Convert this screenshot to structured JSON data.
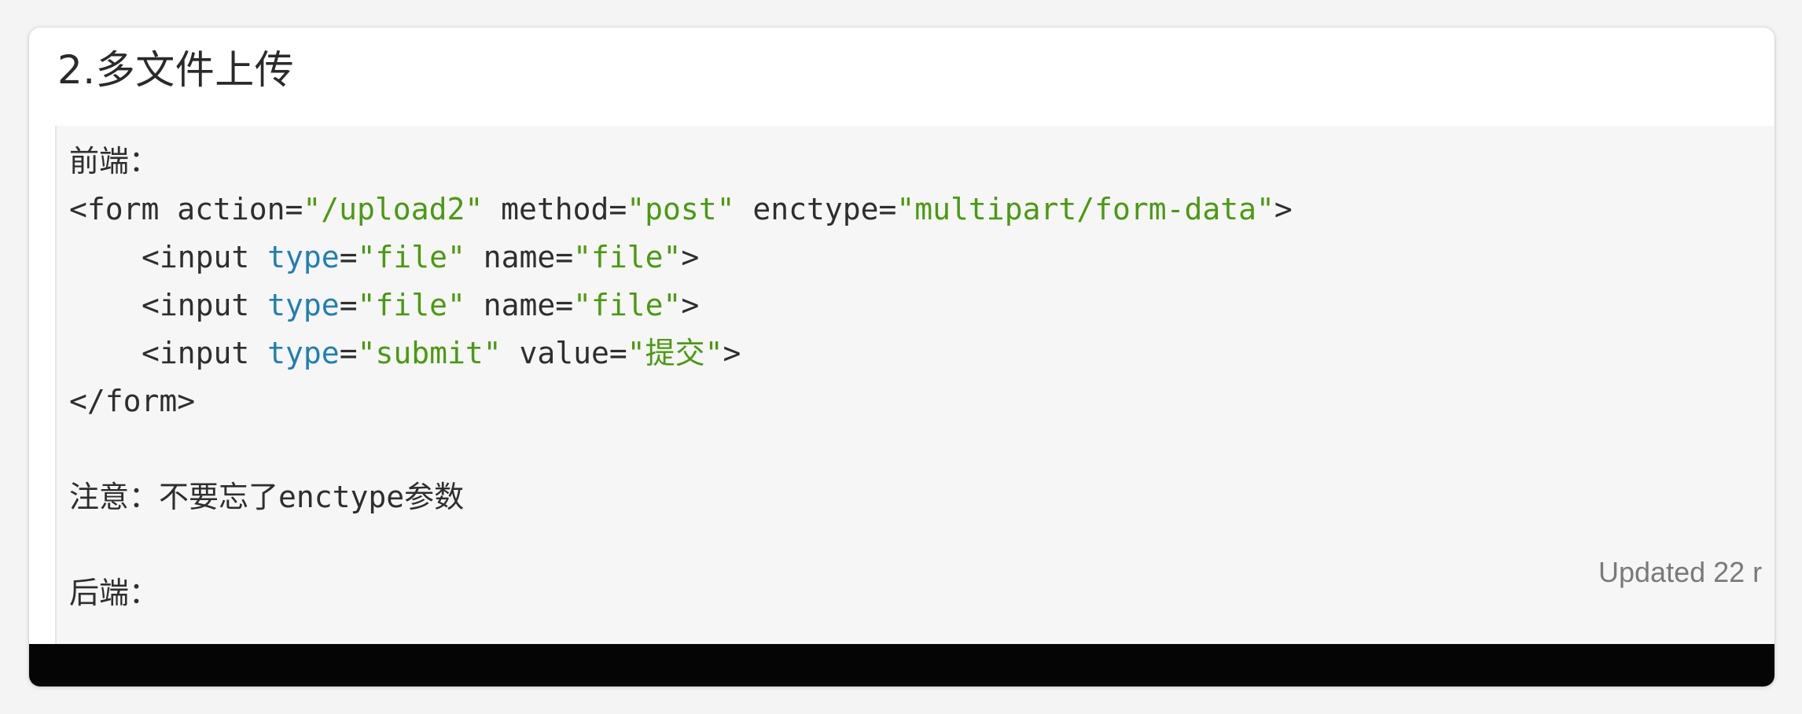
{
  "heading": "2.多文件上传",
  "code": {
    "frontend_label": "前端：",
    "form_open": {
      "tag_start": "<form",
      "attr1_name": " action=",
      "attr1_value": "\"/upload2\"",
      "attr2_name": " method=",
      "attr2_value": "\"post\"",
      "attr3_name": " enctype=",
      "attr3_value": "\"multipart/form-data\"",
      "tag_end": ">"
    },
    "inputs": [
      {
        "tag_start": "<input",
        "type_attr": "type",
        "eq1": "=",
        "type_value": "\"file\"",
        "second_attr": " name=",
        "second_value": "\"file\"",
        "tag_end": ">"
      },
      {
        "tag_start": "<input",
        "type_attr": "type",
        "eq1": "=",
        "type_value": "\"file\"",
        "second_attr": " name=",
        "second_value": "\"file\"",
        "tag_end": ">"
      },
      {
        "tag_start": "<input",
        "type_attr": "type",
        "eq1": "=",
        "type_value": "\"submit\"",
        "second_attr": " value=",
        "second_value": "\"提交\"",
        "tag_end": ">"
      }
    ],
    "form_close": "</form>",
    "note": "注意：不要忘了enctype参数",
    "backend_label": "后端："
  },
  "updated_note": "Updated 22 r",
  "colors": {
    "attribute": "#1f7fb4",
    "string": "#4a9a11",
    "text": "#2e2e2e",
    "panel_background": "#f6f6f6",
    "bottom_bar": "#050505"
  }
}
